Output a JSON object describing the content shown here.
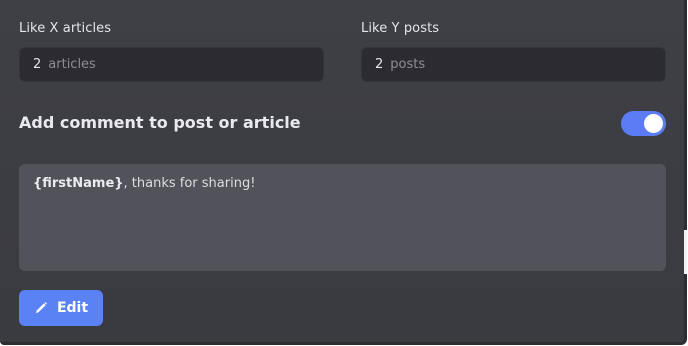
{
  "articles": {
    "label": "Like X articles",
    "value": "2",
    "unit": "articles"
  },
  "posts": {
    "label": "Like Y posts",
    "value": "2",
    "unit": "posts"
  },
  "comment_section": {
    "title": "Add comment to post or article",
    "toggle_on": true,
    "message_variable": "{firstName}",
    "message_text": ", thanks for sharing!"
  },
  "edit_button": {
    "label": "Edit",
    "icon": "pencil-icon"
  },
  "colors": {
    "accent": "#5b82f4",
    "panel": "#3d3d44",
    "input_bg": "#2b2b31",
    "comment_bg": "#52525b"
  }
}
